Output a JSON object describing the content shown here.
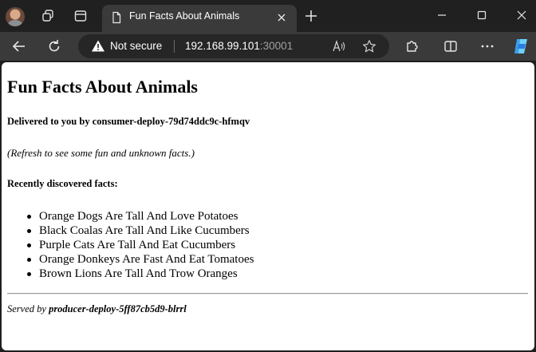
{
  "browser": {
    "tab": {
      "title": "Fun Facts About Animals"
    },
    "address": {
      "security_label": "Not secure",
      "host": "192.168.99.101",
      "port": ":30001"
    },
    "icons": {
      "profile": "profile-avatar-icon",
      "workspaces": "workspaces-icon",
      "tab_actions": "tab-actions-icon",
      "favicon": "page-favicon-icon",
      "close_tab": "close-icon",
      "new_tab": "plus-icon",
      "minimize": "minimize-icon",
      "maximize": "maximize-icon",
      "close_window": "close-window-icon",
      "back": "back-arrow-icon",
      "refresh": "refresh-icon",
      "warning": "warning-triangle-icon",
      "read_aloud": "read-aloud-icon",
      "favorites": "star-icon",
      "extensions": "extensions-icon",
      "split_screen": "split-screen-icon",
      "more": "more-icon",
      "copilot": "copilot-icon"
    },
    "colors": {
      "chrome_dark": "#202020",
      "toolbar": "#3a3a3a",
      "omnibox": "#262626",
      "copilot": "#3aa0f0"
    }
  },
  "page": {
    "heading": "Fun Facts About Animals",
    "delivered": "Delivered to you by consumer-deploy-79d74ddc9c-hfmqv",
    "refresh_note": "(Refresh to see some fun and unknown facts.)",
    "recent_label": "Recently discovered facts:",
    "facts": [
      "Orange Dogs Are Tall And Love Potatoes",
      "Black Coalas Are Tall And Like Cucumbers",
      "Purple Cats Are Tall And Eat Cucumbers",
      "Orange Donkeys Are Fast And Eat Tomatoes",
      "Brown Lions Are Tall And Trow Oranges"
    ],
    "served_prefix": "Served by ",
    "served_by": "producer-deploy-5ff87cb5d9-blrrl"
  }
}
